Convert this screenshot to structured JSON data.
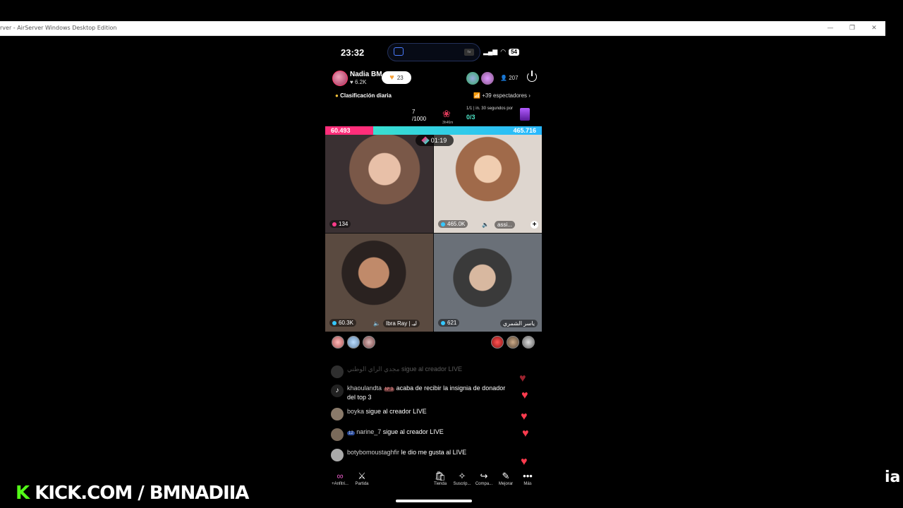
{
  "window": {
    "title": "rver - AirServer Windows Desktop Edition",
    "minimize": "—",
    "restore": "❐",
    "close": "✕"
  },
  "status": {
    "time": "23:32",
    "battery": "54"
  },
  "host": {
    "name": "Nadia BM",
    "likes": "6.2K",
    "like_pill": "23",
    "viewers": "207"
  },
  "ranking": {
    "label": "Clasificación diaria",
    "spectators": "+39 espectadores"
  },
  "goal": {
    "progress_line1": "7",
    "progress_line2": "/1000",
    "time_left": "3h46m",
    "round_label": "1/1 | in. 30 segundos por",
    "round_score": "0/3"
  },
  "battle": {
    "left_score": "60.493",
    "right_score": "465.716",
    "timer": "01:19"
  },
  "tiles": [
    {
      "stat": "134"
    },
    {
      "stat": "465.0K",
      "name": "assi..."
    },
    {
      "stat": "60.3K",
      "name": "Ibra Ray | ليـ"
    },
    {
      "stat": "621",
      "name": "ياسر الشمري"
    }
  ],
  "chat": [
    {
      "user": "مجدي الراي الوطني",
      "msg": "sigue al creador LIVE"
    },
    {
      "user": "khaoulandta",
      "badge": "Nº 3",
      "msg": "acaba de recibir la insignia de donador del top 3"
    },
    {
      "user": "boyka",
      "msg": "sigue al creador LIVE"
    },
    {
      "user": "narine_7",
      "badge": "12",
      "msg": "sigue al creador LIVE"
    },
    {
      "user": "botybomoustaghfir",
      "msg": "le dio me gusta al LIVE"
    }
  ],
  "toolbar": {
    "anfitrion": "+Anfitri...",
    "partida": "Partida",
    "tienda": "Tienda",
    "suscrip": "Suscrip...",
    "compa": "Compa...",
    "mejorar": "Mejorar",
    "mas": "Más"
  },
  "overlay": {
    "kick_k": "K",
    "kick_text": "KICK.COM / BMNADIIA",
    "ia": "ia"
  },
  "colors": {
    "pink": "#ff2e7a",
    "cyan": "#39e0d0",
    "kick_green": "#53fc18",
    "heart": "#ff3b4e"
  }
}
